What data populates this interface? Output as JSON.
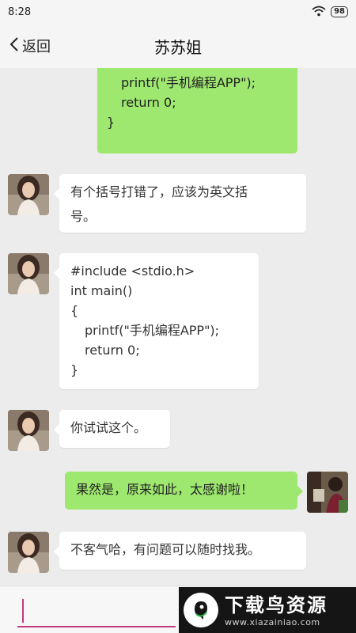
{
  "status": {
    "time": "8:28",
    "battery": "98"
  },
  "header": {
    "back_label": "返回",
    "title": "苏苏姐"
  },
  "messages": [
    {
      "side": "right",
      "code": [
        "printf(\"手机编程APP\");",
        "return 0;",
        "}"
      ]
    },
    {
      "side": "left",
      "lines": [
        "有个括号打错了，应该为英文括",
        "号。"
      ]
    },
    {
      "side": "left",
      "code": [
        "#include <stdio.h>",
        "int main()",
        "{",
        "printf(\"手机编程APP\");",
        "return 0;",
        "}"
      ]
    },
    {
      "side": "left",
      "text": "你试试这个。"
    },
    {
      "side": "right",
      "text": "果然是，原来如此，太感谢啦！"
    },
    {
      "side": "left",
      "text": "不客气哈，有问题可以随时找我。"
    }
  ],
  "input": {
    "value": ""
  },
  "watermark": {
    "title": "下载鸟资源",
    "url": "www.xiazainiao.com",
    "logo_icon": "bird-icon"
  },
  "colors": {
    "outgoing_bubble": "#9ee870",
    "incoming_bubble": "#ffffff",
    "background": "#ececec",
    "input_accent": "#c23a7d"
  }
}
